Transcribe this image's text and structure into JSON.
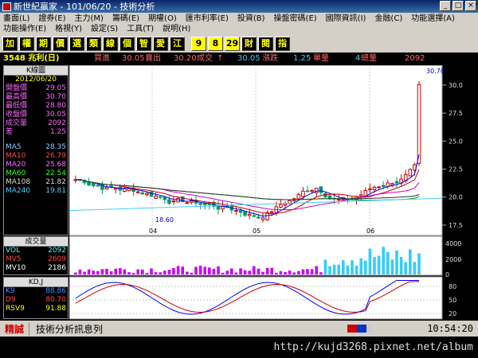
{
  "window": {
    "title": "新世紀贏家 - 101/06/20 - 技術分析",
    "min": "_",
    "max": "□",
    "close": "×"
  },
  "menu": [
    "畫面(L)",
    "證券(E)",
    "主力(M)",
    "籌碼(E)",
    "期權(O)",
    "匯市利率(E)",
    "投資(B)",
    "操盤密碼(E)",
    "國際資訊(I)",
    "金融(C)",
    "功能選擇(A)",
    "功能操作(E)",
    "格視(Y)",
    "設定(S)",
    "工具(T)",
    "說明(H)"
  ],
  "toolbar": [
    "加",
    "權",
    "期",
    "價",
    "選",
    "類",
    "線",
    "個",
    "智",
    "愛",
    "江",
    "9",
    "8",
    "29",
    "財",
    "閱",
    "指"
  ],
  "info": {
    "code": "3548 兆利(日)",
    "bid_label": "買進",
    "bid": "30.05",
    "ask_label": "賣出",
    "ask": "30.20",
    "trade_label": "成交",
    "trade": "30.05",
    "change_label": "↑",
    "change_word": "漲跌",
    "change": "1.25",
    "vol_label": "單量",
    "vol": "4",
    "total_label": "總量",
    "total": "2092"
  },
  "kpanel": {
    "header": "K線圖",
    "date": "2012/06/20",
    "rows": [
      [
        "開盤價",
        "29.05"
      ],
      [
        "最高價",
        "30.70"
      ],
      [
        "最低價",
        "28.80"
      ],
      [
        "收盤價",
        "30.05"
      ],
      [
        "成交量",
        "2092"
      ],
      [
        "差",
        "1.25"
      ]
    ],
    "ma": [
      [
        "MA5",
        "28.35",
        "#8cf"
      ],
      [
        "MA10",
        "26.79",
        "#f44"
      ],
      [
        "MA20",
        "25.68",
        "#f6f"
      ],
      [
        "MA60",
        "22.54",
        "#3f3"
      ],
      [
        "MA108",
        "21.82",
        "#ddd"
      ],
      [
        "MA240",
        "19.81",
        "#4cf"
      ]
    ]
  },
  "vpanel": {
    "header": "成交量",
    "rows": [
      [
        "VOL",
        "2092",
        "#3ff"
      ],
      [
        "MV5",
        "2609",
        "#f44"
      ],
      [
        "MV10",
        "2186",
        "#fff"
      ]
    ]
  },
  "kdpanel": {
    "header": "KD,J",
    "rows": [
      [
        "K9",
        "88.86",
        "#48f"
      ],
      [
        "D9",
        "80.70",
        "#f44"
      ],
      [
        "RSV9",
        "91.88",
        "#ff0"
      ]
    ]
  },
  "price_axis": [
    "30.0",
    "27.5",
    "25.0",
    "22.5",
    "20.0",
    "17.5"
  ],
  "price_top": "30.70",
  "low_mark": "18.60",
  "months": [
    "04",
    "05",
    "06"
  ],
  "vol_axis": [
    "4000",
    "2000",
    "0"
  ],
  "kd_axis": [
    "80",
    "50",
    "20"
  ],
  "status": {
    "logo": "精誠",
    "text": "技術分析訊息列",
    "time": "10:54:20"
  },
  "url": "http://kujd3268.pixnet.net/album"
}
